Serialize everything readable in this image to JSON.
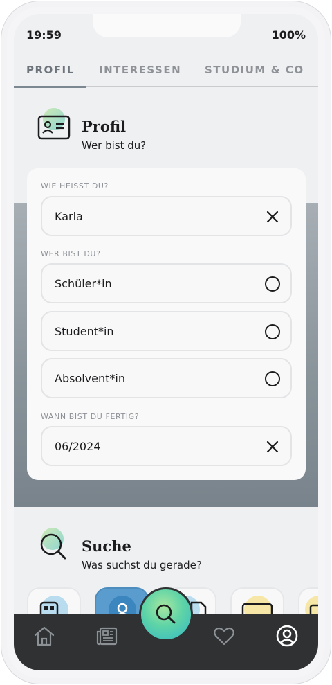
{
  "status_bar": {
    "time": "19:59",
    "battery": "100%"
  },
  "tabs": [
    {
      "label": "PROFIL",
      "active": true
    },
    {
      "label": "INTERESSEN",
      "active": false
    },
    {
      "label": "STUDIUM & CO",
      "active": false
    }
  ],
  "profile_section": {
    "title": "Profil",
    "subtitle": "Wer bist du?",
    "icon": "id-card-icon"
  },
  "form": {
    "name_label": "WIE HEISST DU?",
    "name_value": "Karla",
    "role_label": "WER BIST DU?",
    "roles": [
      {
        "label": "Schüler*in",
        "selected": false
      },
      {
        "label": "Student*in",
        "selected": false
      },
      {
        "label": "Absolvent*in",
        "selected": false
      }
    ],
    "finish_label": "WANN BIST DU FERTIG?",
    "finish_value": "06/2024"
  },
  "search_section": {
    "title": "Suche",
    "subtitle": "Was suchst du gerade?",
    "icon": "magnifier-icon"
  },
  "bottom_nav": [
    {
      "name": "home-icon",
      "active": false
    },
    {
      "name": "news-icon",
      "active": false
    },
    {
      "name": "search-icon",
      "active": true
    },
    {
      "name": "heart-icon",
      "active": false
    },
    {
      "name": "profile-icon",
      "active": true
    }
  ],
  "colors": {
    "accent_blue": "#5a9ccd",
    "accent_green": "#5fd4a7",
    "nav_bar": "#2f3133",
    "band_gray": "#8a949b"
  }
}
